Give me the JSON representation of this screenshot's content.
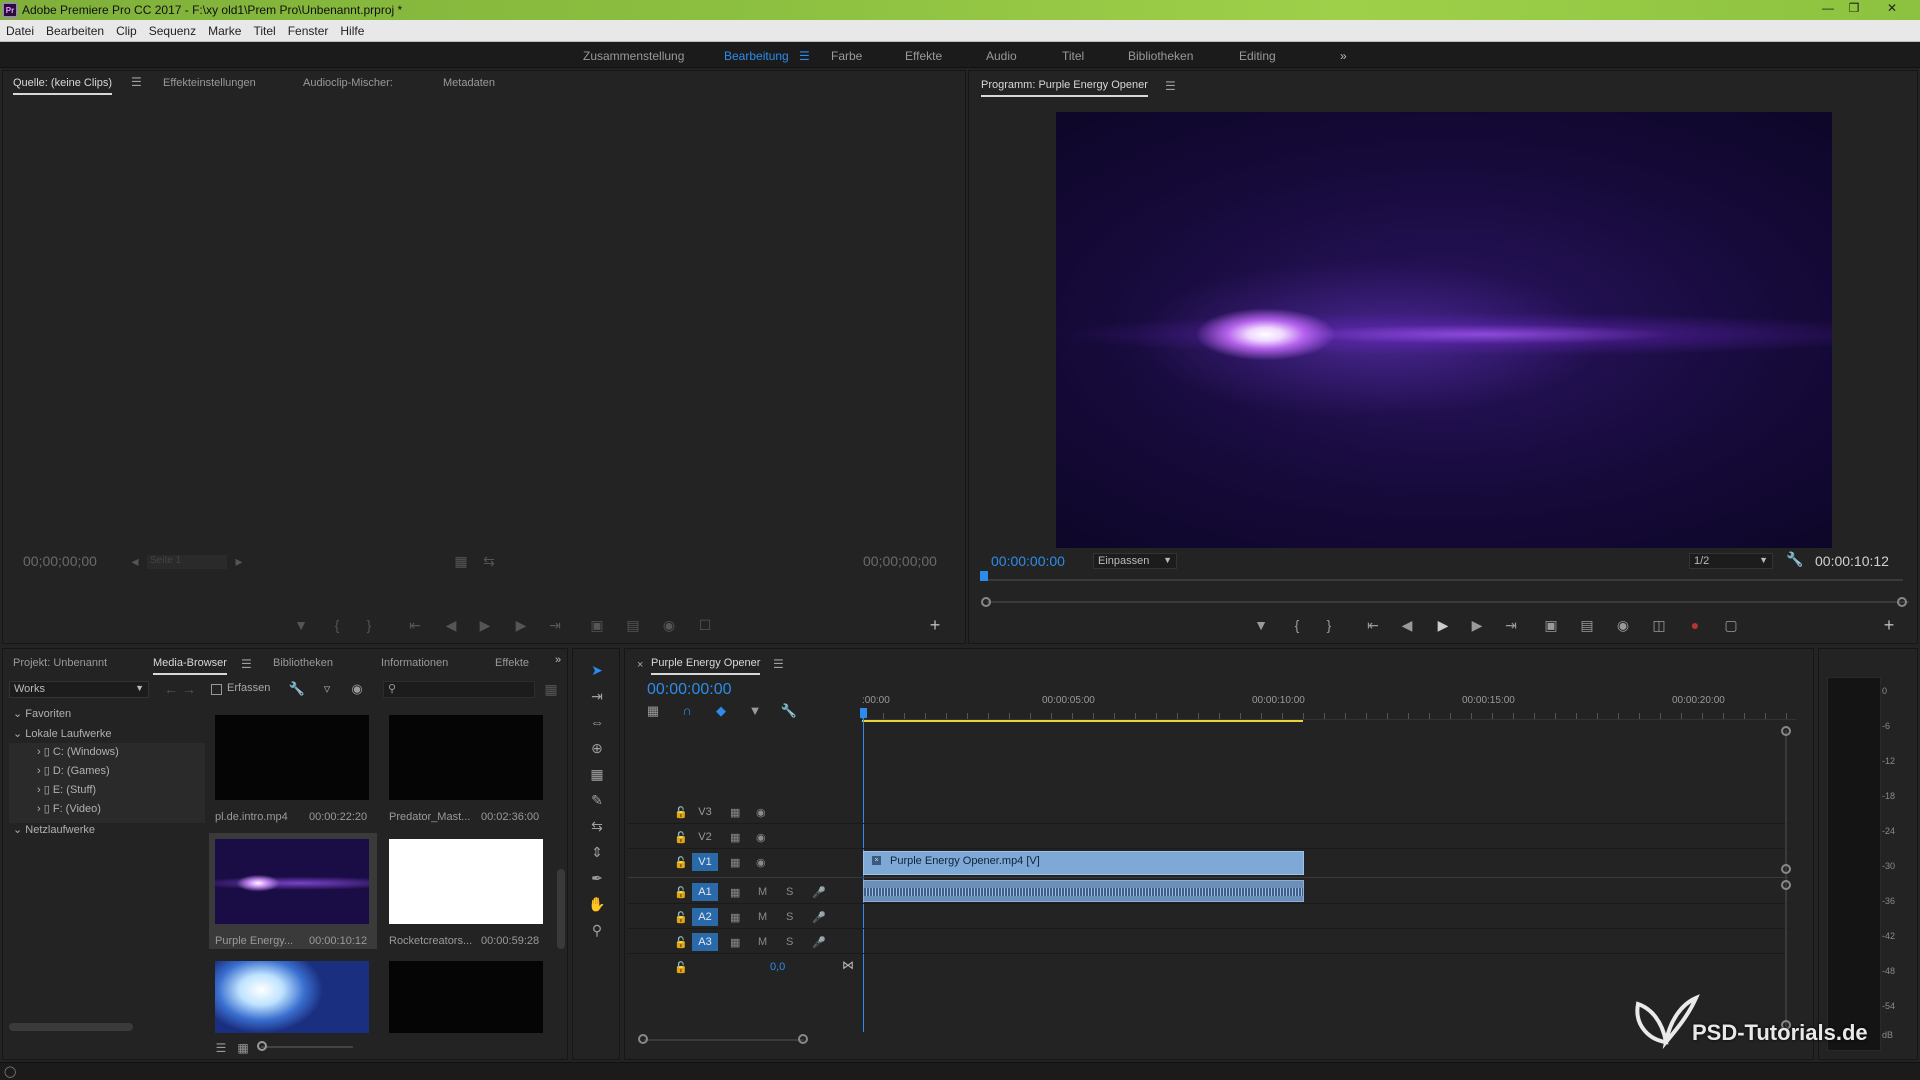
{
  "window": {
    "title": "Adobe Premiere Pro CC 2017 - F:\\xy old1\\Prem Pro\\Unbenannt.prproj *",
    "app_icon": "Pr"
  },
  "menu": [
    "Datei",
    "Bearbeiten",
    "Clip",
    "Sequenz",
    "Marke",
    "Titel",
    "Fenster",
    "Hilfe"
  ],
  "workspaces": {
    "items": [
      "Zusammenstellung",
      "Bearbeitung",
      "Farbe",
      "Effekte",
      "Audio",
      "Titel",
      "Bibliotheken",
      "Editing"
    ],
    "active": "Bearbeitung",
    "overflow": "»"
  },
  "source": {
    "tabs": [
      "Quelle: (keine Clips)",
      "Effekteinstellungen",
      "Audioclip-Mischer:",
      "Metadaten"
    ],
    "tc_left": "00;00;00;00",
    "tc_right": "00;00;00;00",
    "page_field": "Seite 1"
  },
  "program": {
    "title": "Programm: Purple Energy Opener",
    "tc_left": "00:00:00:00",
    "fit": "Einpassen",
    "resolution": "1/2",
    "tc_right": "00:00:10:12"
  },
  "project": {
    "tabs": [
      "Projekt: Unbenannt",
      "Media-Browser",
      "Bibliotheken",
      "Informationen",
      "Effekte"
    ],
    "location": "Works",
    "ingest_label": "Erfassen",
    "tree": {
      "favorites": "Favoriten",
      "local": "Lokale Laufwerke",
      "drives": [
        "C: (Windows)",
        "D: (Games)",
        "E: (Stuff)",
        "F: (Video)"
      ],
      "network": "Netzlaufwerke"
    },
    "thumbs": [
      {
        "name": "pl.de.intro.mp4",
        "duration": "00:00:22:20"
      },
      {
        "name": "Predator_Mast...",
        "duration": "00:02:36:00"
      },
      {
        "name": "Purple Energy...",
        "duration": "00:00:10:12"
      },
      {
        "name": "Rocketcreators...",
        "duration": "00:00:59:28"
      }
    ]
  },
  "timeline": {
    "sequence": "Purple Energy Opener",
    "timecode": "00:00:00:00",
    "ruler": [
      ":00:00",
      "00:00:05:00",
      "00:00:10:00",
      "00:00:15:00",
      "00:00:20:00"
    ],
    "video_tracks": [
      "V3",
      "V2",
      "V1"
    ],
    "audio_tracks": [
      "A1",
      "A2",
      "A3"
    ],
    "mute_label": "M",
    "solo_label": "S",
    "master_value": "0,0",
    "clip_video": "Purple Energy Opener.mp4 [V]",
    "clip_duration_seconds": 10.5
  },
  "meter": {
    "scale": [
      "0",
      "-6",
      "-12",
      "-18",
      "-24",
      "-30",
      "-36",
      "-42",
      "-48",
      "-54",
      "dB"
    ]
  },
  "watermark": "PSD-Tutorials.de",
  "colors": {
    "accent": "#2d8ceb",
    "clip_video": "#7ea9d6",
    "clip_audio": "#6b8fb8",
    "timecode": "#2d8ceb",
    "titlebar": "#8cc23f"
  }
}
